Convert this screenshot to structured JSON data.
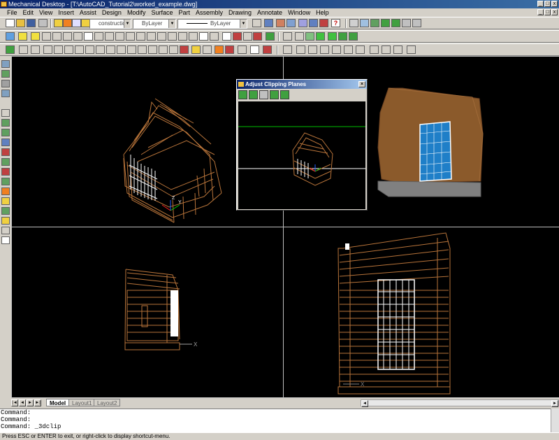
{
  "window": {
    "title": "Mechanical Desktop - [T:\\AutoCAD_Tutorial2\\worked_example.dwg]"
  },
  "menu": [
    "File",
    "Edit",
    "View",
    "Insert",
    "Assist",
    "Design",
    "Modify",
    "Surface",
    "Part",
    "Assembly",
    "Drawing",
    "Annotate",
    "Window",
    "Help"
  ],
  "toolbar": {
    "layer_value": "construction",
    "color_value": "ByLayer",
    "linetype_value": "ByLayer",
    "lineweight_value": "ByLayer"
  },
  "dialog": {
    "title": "Adjust Clipping Planes",
    "close_glyph": "×"
  },
  "viewport_axes": {
    "x_label": "X",
    "y_label": "Y",
    "z_label": "Z"
  },
  "layout_tabs": [
    "Model",
    "Layout1",
    "Layout2"
  ],
  "command": {
    "history": [
      "Command:",
      "Command:"
    ],
    "current": "Command:  _3dclip"
  },
  "status": {
    "message": "Press ESC or ENTER to exit, or right-click to display shortcut-menu."
  },
  "colors": {
    "wireframe": "#b8743a",
    "shaded_body": "#8b5a2b",
    "window_glass": "#1f7fc8",
    "clip_plane_front": "#00c000",
    "background": "#000000"
  }
}
